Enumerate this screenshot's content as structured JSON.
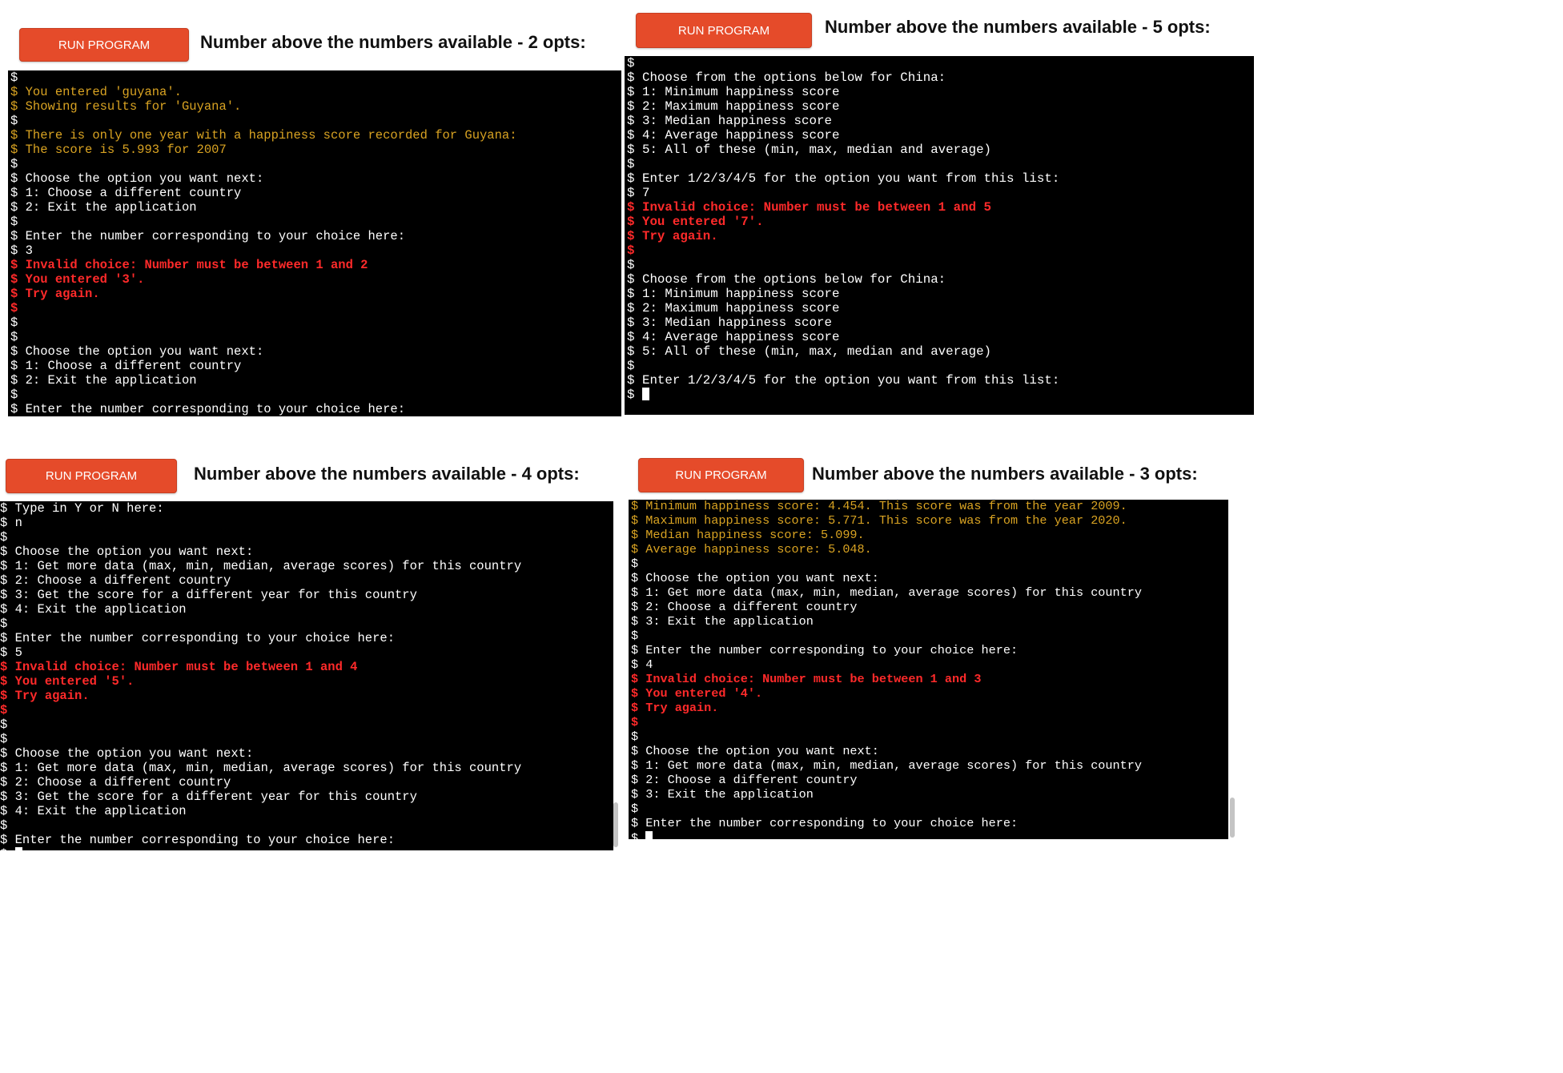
{
  "run_button_label": "RUN PROGRAM",
  "panels": [
    {
      "heading": "Number above the numbers available - 2 opts:",
      "lines": [
        {
          "p": "$",
          "t": "",
          "c": "w"
        },
        {
          "p": "$",
          "t": " You entered 'guyana'.",
          "c": "y"
        },
        {
          "p": "$",
          "t": " Showing results for 'Guyana'.",
          "c": "y"
        },
        {
          "p": "$",
          "t": "",
          "c": "w"
        },
        {
          "p": "$",
          "t": " There is only one year with a happiness score recorded for Guyana:",
          "c": "y"
        },
        {
          "p": "$",
          "t": " The score is 5.993 for 2007",
          "c": "y"
        },
        {
          "p": "$",
          "t": "",
          "c": "w"
        },
        {
          "p": "$",
          "t": " Choose the option you want next:",
          "c": "w"
        },
        {
          "p": "$",
          "t": " 1: Choose a different country",
          "c": "w"
        },
        {
          "p": "$",
          "t": " 2: Exit the application",
          "c": "w"
        },
        {
          "p": "$",
          "t": "",
          "c": "w"
        },
        {
          "p": "$",
          "t": " Enter the number corresponding to your choice here:",
          "c": "w"
        },
        {
          "p": "$",
          "t": " 3",
          "c": "w"
        },
        {
          "p": "$",
          "t": " Invalid choice: Number must be between 1 and 2",
          "c": "r"
        },
        {
          "p": "$",
          "t": " You entered '3'.",
          "c": "r"
        },
        {
          "p": "$",
          "t": " Try again.",
          "c": "r"
        },
        {
          "p": "$",
          "t": "",
          "c": "r"
        },
        {
          "p": "$",
          "t": "",
          "c": "w"
        },
        {
          "p": "$",
          "t": "",
          "c": "w"
        },
        {
          "p": "$",
          "t": " Choose the option you want next:",
          "c": "w"
        },
        {
          "p": "$",
          "t": " 1: Choose a different country",
          "c": "w"
        },
        {
          "p": "$",
          "t": " 2: Exit the application",
          "c": "w"
        },
        {
          "p": "$",
          "t": "",
          "c": "w"
        },
        {
          "p": "$",
          "t": " Enter the number corresponding to your choice here:",
          "c": "w"
        },
        {
          "p": "$",
          "t": " ",
          "c": "w",
          "cursor": true
        }
      ]
    },
    {
      "heading": "Number above the numbers available - 5 opts:",
      "lines": [
        {
          "p": "$",
          "t": "",
          "c": "w"
        },
        {
          "p": "$",
          "t": " Choose from the options below for China:",
          "c": "w"
        },
        {
          "p": "$",
          "t": " 1: Minimum happiness score",
          "c": "w"
        },
        {
          "p": "$",
          "t": " 2: Maximum happiness score",
          "c": "w"
        },
        {
          "p": "$",
          "t": " 3: Median happiness score",
          "c": "w"
        },
        {
          "p": "$",
          "t": " 4: Average happiness score",
          "c": "w"
        },
        {
          "p": "$",
          "t": " 5: All of these (min, max, median and average)",
          "c": "w"
        },
        {
          "p": "$",
          "t": "",
          "c": "w"
        },
        {
          "p": "$",
          "t": " Enter 1/2/3/4/5 for the option you want from this list:",
          "c": "w"
        },
        {
          "p": "$",
          "t": " 7",
          "c": "w"
        },
        {
          "p": "$",
          "t": " Invalid choice: Number must be between 1 and 5",
          "c": "r"
        },
        {
          "p": "$",
          "t": " You entered '7'.",
          "c": "r"
        },
        {
          "p": "$",
          "t": " Try again.",
          "c": "r"
        },
        {
          "p": "$",
          "t": "",
          "c": "r"
        },
        {
          "p": "$",
          "t": "",
          "c": "w"
        },
        {
          "p": "$",
          "t": " Choose from the options below for China:",
          "c": "w"
        },
        {
          "p": "$",
          "t": " 1: Minimum happiness score",
          "c": "w"
        },
        {
          "p": "$",
          "t": " 2: Maximum happiness score",
          "c": "w"
        },
        {
          "p": "$",
          "t": " 3: Median happiness score",
          "c": "w"
        },
        {
          "p": "$",
          "t": " 4: Average happiness score",
          "c": "w"
        },
        {
          "p": "$",
          "t": " 5: All of these (min, max, median and average)",
          "c": "w"
        },
        {
          "p": "$",
          "t": "",
          "c": "w"
        },
        {
          "p": "$",
          "t": " Enter 1/2/3/4/5 for the option you want from this list:",
          "c": "w"
        },
        {
          "p": "$",
          "t": " ",
          "c": "w",
          "cursor": true
        }
      ]
    },
    {
      "heading": "Number above the numbers available - 4 opts:",
      "lines": [
        {
          "p": "$",
          "t": " Type in Y or N here:",
          "c": "w"
        },
        {
          "p": "$",
          "t": " n",
          "c": "w"
        },
        {
          "p": "$",
          "t": "",
          "c": "w"
        },
        {
          "p": "$",
          "t": " Choose the option you want next:",
          "c": "w"
        },
        {
          "p": "$",
          "t": " 1: Get more data (max, min, median, average scores) for this country",
          "c": "w"
        },
        {
          "p": "$",
          "t": " 2: Choose a different country",
          "c": "w"
        },
        {
          "p": "$",
          "t": " 3: Get the score for a different year for this country",
          "c": "w"
        },
        {
          "p": "$",
          "t": " 4: Exit the application",
          "c": "w"
        },
        {
          "p": "$",
          "t": "",
          "c": "w"
        },
        {
          "p": "$",
          "t": " Enter the number corresponding to your choice here:",
          "c": "w"
        },
        {
          "p": "$",
          "t": " 5",
          "c": "w"
        },
        {
          "p": "$",
          "t": " Invalid choice: Number must be between 1 and 4",
          "c": "r"
        },
        {
          "p": "$",
          "t": " You entered '5'.",
          "c": "r"
        },
        {
          "p": "$",
          "t": " Try again.",
          "c": "r"
        },
        {
          "p": "$",
          "t": "",
          "c": "r"
        },
        {
          "p": "$",
          "t": "",
          "c": "w"
        },
        {
          "p": "$",
          "t": "",
          "c": "w"
        },
        {
          "p": "$",
          "t": " Choose the option you want next:",
          "c": "w"
        },
        {
          "p": "$",
          "t": " 1: Get more data (max, min, median, average scores) for this country",
          "c": "w"
        },
        {
          "p": "$",
          "t": " 2: Choose a different country",
          "c": "w"
        },
        {
          "p": "$",
          "t": " 3: Get the score for a different year for this country",
          "c": "w"
        },
        {
          "p": "$",
          "t": " 4: Exit the application",
          "c": "w"
        },
        {
          "p": "$",
          "t": "",
          "c": "w"
        },
        {
          "p": "$",
          "t": " Enter the number corresponding to your choice here:",
          "c": "w"
        },
        {
          "p": "$",
          "t": " ",
          "c": "w",
          "cursor": true
        }
      ]
    },
    {
      "heading": "Number above the numbers available - 3 opts:",
      "lines": [
        {
          "p": "$",
          "t": " Minimum happiness score: 4.454. This score was from the year 2009.",
          "c": "y"
        },
        {
          "p": "$",
          "t": " Maximum happiness score: 5.771. This score was from the year 2020.",
          "c": "y"
        },
        {
          "p": "$",
          "t": " Median happiness score: 5.099.",
          "c": "y"
        },
        {
          "p": "$",
          "t": " Average happiness score: 5.048.",
          "c": "y"
        },
        {
          "p": "$",
          "t": "",
          "c": "w"
        },
        {
          "p": "$",
          "t": " Choose the option you want next:",
          "c": "w"
        },
        {
          "p": "$",
          "t": " 1: Get more data (max, min, median, average scores) for this country",
          "c": "w"
        },
        {
          "p": "$",
          "t": " 2: Choose a different country",
          "c": "w"
        },
        {
          "p": "$",
          "t": " 3: Exit the application",
          "c": "w"
        },
        {
          "p": "$",
          "t": "",
          "c": "w"
        },
        {
          "p": "$",
          "t": " Enter the number corresponding to your choice here:",
          "c": "w"
        },
        {
          "p": "$",
          "t": " 4",
          "c": "w"
        },
        {
          "p": "$",
          "t": " Invalid choice: Number must be between 1 and 3",
          "c": "r"
        },
        {
          "p": "$",
          "t": " You entered '4'.",
          "c": "r"
        },
        {
          "p": "$",
          "t": " Try again.",
          "c": "r"
        },
        {
          "p": "$",
          "t": "",
          "c": "r"
        },
        {
          "p": "$",
          "t": "",
          "c": "w"
        },
        {
          "p": "$",
          "t": " Choose the option you want next:",
          "c": "w"
        },
        {
          "p": "$",
          "t": " 1: Get more data (max, min, median, average scores) for this country",
          "c": "w"
        },
        {
          "p": "$",
          "t": " 2: Choose a different country",
          "c": "w"
        },
        {
          "p": "$",
          "t": " 3: Exit the application",
          "c": "w"
        },
        {
          "p": "$",
          "t": "",
          "c": "w"
        },
        {
          "p": "$",
          "t": " Enter the number corresponding to your choice here:",
          "c": "w"
        },
        {
          "p": "$",
          "t": " ",
          "c": "w",
          "cursor": true
        }
      ]
    }
  ]
}
